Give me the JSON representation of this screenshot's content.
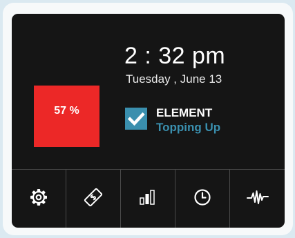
{
  "battery": {
    "text": "57 %",
    "level_percent": 57,
    "color": "#ec2827"
  },
  "clock": {
    "time": "2 : 32 pm",
    "date": "Tuesday , June 13"
  },
  "device": {
    "name": "ELEMENT",
    "status": "Topping Up",
    "checked": true,
    "accent_color": "#3a8fae"
  },
  "toolbar": {
    "items": [
      {
        "icon": "gear-icon"
      },
      {
        "icon": "payment-icon"
      },
      {
        "icon": "bar-chart-icon"
      },
      {
        "icon": "clock-icon"
      },
      {
        "icon": "waveform-icon"
      }
    ]
  }
}
